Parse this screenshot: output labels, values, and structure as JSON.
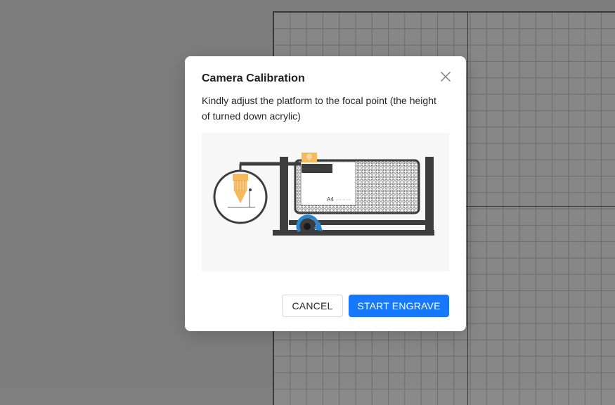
{
  "dialog": {
    "title": "Camera Calibration",
    "description": "Kindly adjust the platform to the focal point (the height of turned down acrylic)",
    "cancel_label": "CANCEL",
    "confirm_label": "START ENGRAVE"
  },
  "illustration": {
    "paper_label": "A4"
  },
  "icons": {
    "close": "close-icon",
    "rotate": "rotate-arrow-icon"
  },
  "colors": {
    "primary": "#1677ff",
    "laser_head": "#f6b95b",
    "machine": "#3d3d3d",
    "arrow": "#2c86c9"
  }
}
